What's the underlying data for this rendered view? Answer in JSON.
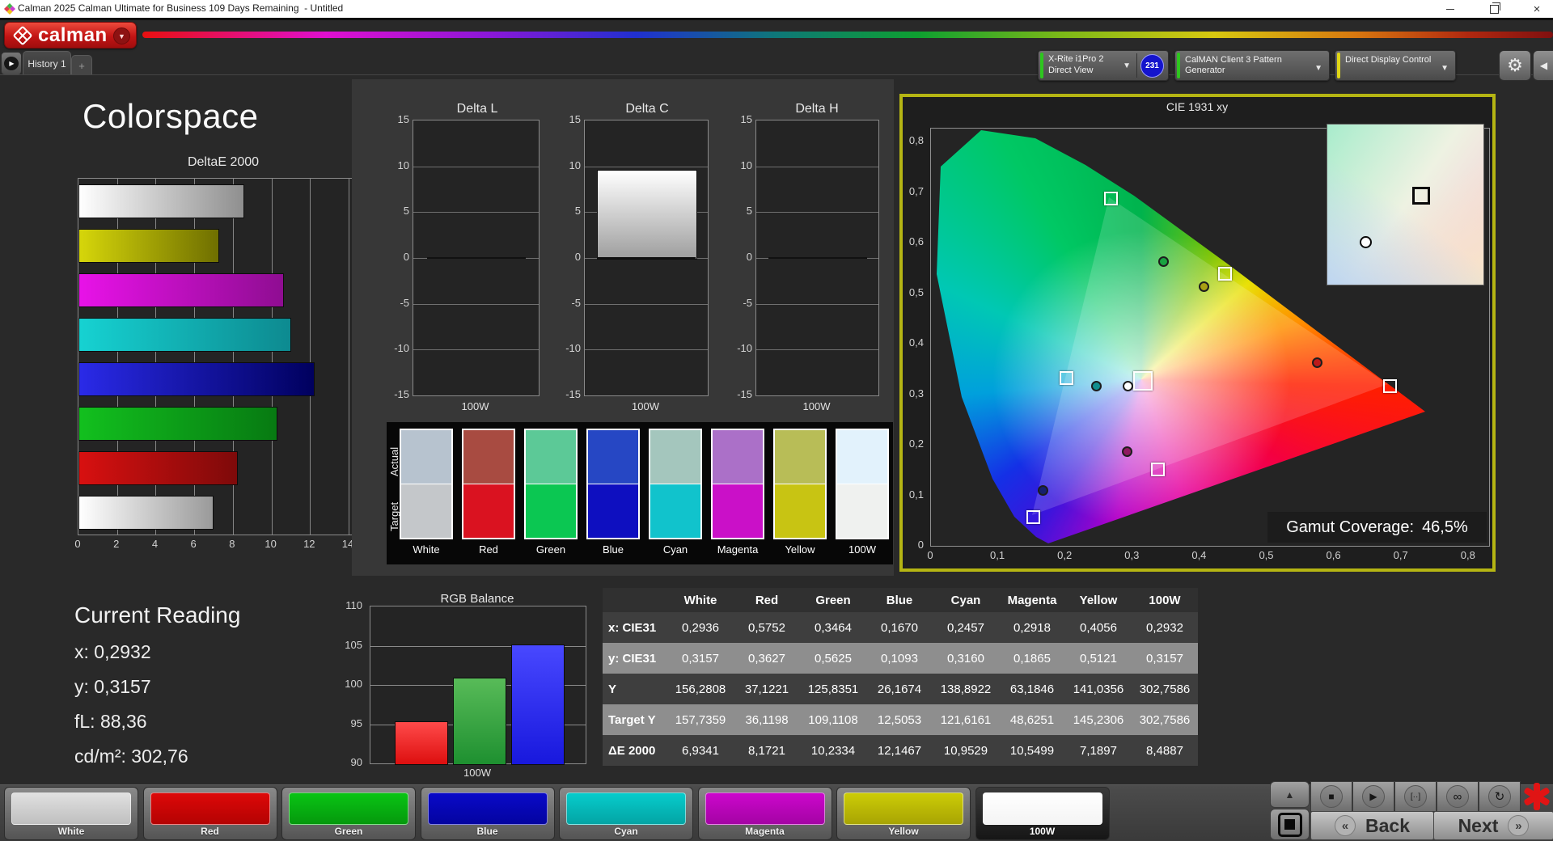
{
  "window": {
    "title": "Calman 2025 Calman Ultimate for Business 109 Days Remaining  - Untitled"
  },
  "brand": {
    "name": "calman"
  },
  "tabs": {
    "active": "History 1",
    "add": "+"
  },
  "toolbar": {
    "meter": {
      "line1": "X-Rite i1Pro 2",
      "line2": "Direct View",
      "badge": "231"
    },
    "generator": {
      "label": "CalMAN Client 3 Pattern Generator"
    },
    "display": {
      "label": "Direct Display Control"
    }
  },
  "page": {
    "title": "Colorspace"
  },
  "chart_data": {
    "deltae": {
      "type": "bar",
      "orientation": "horizontal",
      "title": "DeltaE 2000",
      "categories": [
        "White",
        "Red",
        "Green",
        "Blue",
        "Cyan",
        "Magenta",
        "Yellow",
        "100W"
      ],
      "values": [
        6.9341,
        8.1721,
        10.2334,
        12.1467,
        10.9529,
        10.5499,
        7.1897,
        8.4887
      ],
      "xlim": [
        0,
        15
      ],
      "xticks": [
        0,
        2,
        4,
        6,
        8,
        10,
        12,
        14
      ],
      "bar_colors": {
        "White": [
          "#ffffff",
          "#9a9a9a"
        ],
        "Red": [
          "#d81010",
          "#7e0a0a"
        ],
        "Green": [
          "#12c01e",
          "#077a12"
        ],
        "Blue": [
          "#2a2ae8",
          "#00005e"
        ],
        "Cyan": [
          "#16d2d2",
          "#0d8a90"
        ],
        "Magenta": [
          "#e812e8",
          "#8f0d92"
        ],
        "Yellow": [
          "#d6d60a",
          "#6f6f00"
        ],
        "100W": [
          "#ffffff",
          "#8f8f8f"
        ]
      }
    },
    "delta_l": {
      "type": "bar",
      "title": "Delta L",
      "category": "100W",
      "value": 0,
      "ylim": [
        -15,
        15
      ],
      "yticks": [
        15,
        10,
        5,
        0,
        -5,
        -10,
        -15
      ]
    },
    "delta_c": {
      "type": "bar",
      "title": "Delta C",
      "category": "100W",
      "value": 9.6,
      "ylim": [
        -15,
        15
      ],
      "yticks": [
        15,
        10,
        5,
        0,
        -5,
        -10,
        -15
      ],
      "bar_colors": [
        "#ffffff",
        "#9e9e9e"
      ]
    },
    "delta_h": {
      "type": "bar",
      "title": "Delta H",
      "category": "100W",
      "value": 0,
      "ylim": [
        -15,
        15
      ],
      "yticks": [
        15,
        10,
        5,
        0,
        -5,
        -10,
        -15
      ]
    },
    "rgb_balance": {
      "type": "bar",
      "title": "RGB Balance",
      "categories": [
        "Red",
        "Green",
        "Blue"
      ],
      "values": [
        95.4,
        100.9,
        105.2
      ],
      "ylim": [
        90,
        110
      ],
      "yticks": [
        110,
        105,
        100,
        95,
        90
      ],
      "xlabel": "100W",
      "bar_colors": {
        "Red": [
          "#ff4a4a",
          "#dd0f0f"
        ],
        "Green": [
          "#58bb58",
          "#1e9030"
        ],
        "Blue": [
          "#4848ff",
          "#1818dd"
        ]
      }
    },
    "cie": {
      "type": "scatter",
      "title": "CIE 1931 xy",
      "xticks": [
        "0",
        "0,1",
        "0,2",
        "0,3",
        "0,4",
        "0,5",
        "0,6",
        "0,7",
        "0,8"
      ],
      "yticks": [
        "0,8",
        "0,7",
        "0,6",
        "0,5",
        "0,4",
        "0,3",
        "0,2",
        "0,1",
        "0"
      ],
      "targets": [
        {
          "name": "White",
          "x": 0.3127,
          "y": 0.329,
          "big": true
        },
        {
          "name": "Red",
          "x": 0.68,
          "y": 0.32
        },
        {
          "name": "Green",
          "x": 0.265,
          "y": 0.69
        },
        {
          "name": "Blue",
          "x": 0.15,
          "y": 0.06
        },
        {
          "name": "Cyan",
          "x": 0.199,
          "y": 0.335
        },
        {
          "name": "Magenta",
          "x": 0.335,
          "y": 0.155
        },
        {
          "name": "Yellow",
          "x": 0.435,
          "y": 0.542
        }
      ],
      "measured": [
        {
          "name": "White",
          "x": 0.2936,
          "y": 0.3157,
          "color": "#ffffff"
        },
        {
          "name": "Red",
          "x": 0.5752,
          "y": 0.3627,
          "color": "#bc1a1a"
        },
        {
          "name": "Green",
          "x": 0.3464,
          "y": 0.5625,
          "color": "#19a341"
        },
        {
          "name": "Blue",
          "x": 0.167,
          "y": 0.1093,
          "color": "#16206e"
        },
        {
          "name": "Cyan",
          "x": 0.2457,
          "y": 0.316,
          "color": "#128f8f"
        },
        {
          "name": "Magenta",
          "x": 0.2918,
          "y": 0.1865,
          "color": "#8f1a60"
        },
        {
          "name": "Yellow",
          "x": 0.4056,
          "y": 0.5121,
          "color": "#a8a014"
        }
      ],
      "gamut_coverage_label": "Gamut Coverage:",
      "gamut_coverage_value": "46,5%"
    }
  },
  "swatch_compare": {
    "row_labels": [
      "Actual",
      "Target"
    ],
    "columns": [
      {
        "label": "White",
        "actual": "#b7c3cf",
        "target": "#c4c7ca"
      },
      {
        "label": "Red",
        "actual": "#a84b41",
        "target": "#da1220"
      },
      {
        "label": "Green",
        "actual": "#5cc997",
        "target": "#0bc752"
      },
      {
        "label": "Blue",
        "actual": "#2647c4",
        "target": "#0e0fc0"
      },
      {
        "label": "Cyan",
        "actual": "#a4c6bd",
        "target": "#11c3cc"
      },
      {
        "label": "Magenta",
        "actual": "#ab70c8",
        "target": "#ca10c8"
      },
      {
        "label": "Yellow",
        "actual": "#b8bd57",
        "target": "#c8c413"
      },
      {
        "label": "100W",
        "actual": "#e2f2fc",
        "target": "#eff1ef"
      }
    ]
  },
  "current_reading": {
    "title": "Current Reading",
    "lines": [
      {
        "label": "x:",
        "value": "0,2932"
      },
      {
        "label": "y:",
        "value": "0,3157"
      },
      {
        "label": "fL:",
        "value": "88,36"
      },
      {
        "label": "cd/m²:",
        "value": "302,76"
      }
    ]
  },
  "results_table": {
    "columns": [
      "White",
      "Red",
      "Green",
      "Blue",
      "Cyan",
      "Magenta",
      "Yellow",
      "100W"
    ],
    "rows": [
      {
        "label": "x: CIE31",
        "values": [
          "0,2936",
          "0,5752",
          "0,3464",
          "0,1670",
          "0,2457",
          "0,2918",
          "0,4056",
          "0,2932"
        ]
      },
      {
        "label": "y: CIE31",
        "values": [
          "0,3157",
          "0,3627",
          "0,5625",
          "0,1093",
          "0,3160",
          "0,1865",
          "0,5121",
          "0,3157"
        ]
      },
      {
        "label": "Y",
        "values": [
          "156,2808",
          "37,1221",
          "125,8351",
          "26,1674",
          "138,8922",
          "63,1846",
          "141,0356",
          "302,7586"
        ]
      },
      {
        "label": "Target Y",
        "values": [
          "157,7359",
          "36,1198",
          "109,1108",
          "12,5053",
          "121,6161",
          "48,6251",
          "145,2306",
          "302,7586"
        ]
      },
      {
        "label": "ΔE 2000",
        "values": [
          "6,9341",
          "8,1721",
          "10,2334",
          "12,1467",
          "10,9529",
          "10,5499",
          "7,1897",
          "8,4887"
        ]
      }
    ]
  },
  "pattern_bar": {
    "tiles": [
      {
        "label": "White",
        "c1": "#e0e0e0",
        "c2": "#bfbfbf"
      },
      {
        "label": "Red",
        "c1": "#dd0808",
        "c2": "#b40303"
      },
      {
        "label": "Green",
        "c1": "#09c414",
        "c2": "#05990d"
      },
      {
        "label": "Blue",
        "c1": "#0909c8",
        "c2": "#0404a0"
      },
      {
        "label": "Cyan",
        "c1": "#06cccc",
        "c2": "#04a4a4"
      },
      {
        "label": "Magenta",
        "c1": "#cc06cc",
        "c2": "#a404a4"
      },
      {
        "label": "Yellow",
        "c1": "#cccc06",
        "c2": "#a8a404"
      },
      {
        "label": "100W",
        "c1": "#ffffff",
        "c2": "#f4f4f4",
        "selected": true
      }
    ]
  },
  "transport": {
    "back": "Back",
    "next": "Next"
  },
  "icons": {
    "gear": "⚙",
    "caret": "▼",
    "collapse_left": "◀",
    "tab_play": "▶",
    "add": "+",
    "close": "×",
    "stop": "■",
    "play": "▶",
    "pattern_options": "[··]",
    "infinity": "∞",
    "refresh": "↻",
    "eject": "▲",
    "back_chevron": "«",
    "next_chevron": "»"
  }
}
